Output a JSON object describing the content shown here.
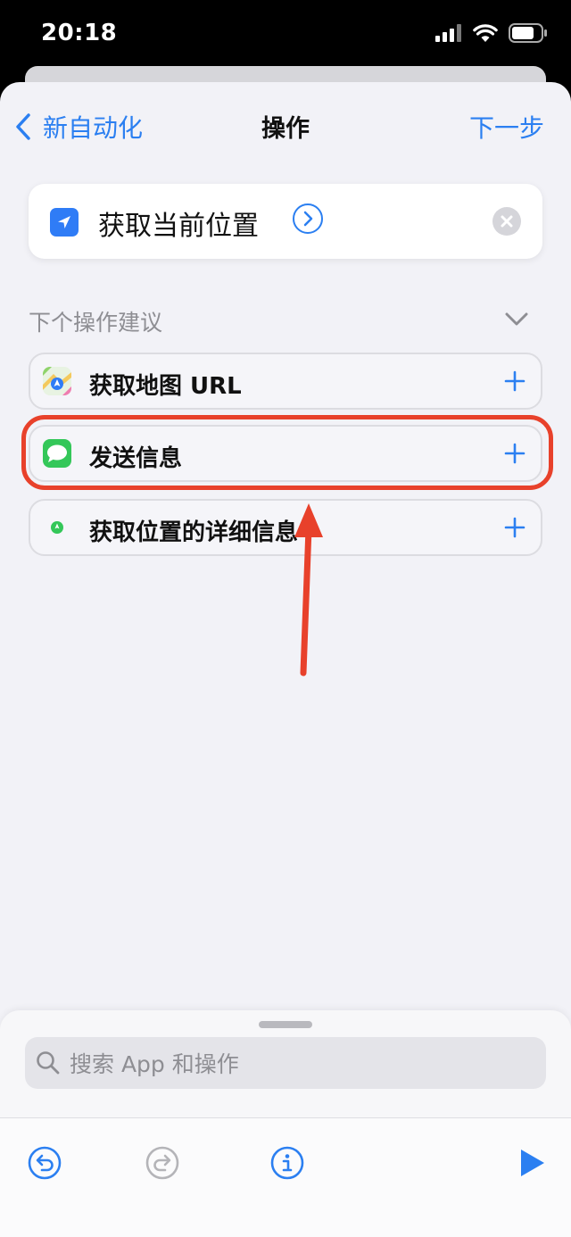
{
  "status_bar": {
    "time": "20:18"
  },
  "nav": {
    "back_label": "新自动化",
    "title": "操作",
    "next_label": "下一步"
  },
  "current_action": {
    "label": "获取当前位置"
  },
  "suggestions": {
    "title": "下个操作建议",
    "items": [
      {
        "label": "获取地图 URL",
        "icon": "maps-app-icon"
      },
      {
        "label": "发送信息",
        "icon": "messages-app-icon"
      },
      {
        "label": "获取位置的详细信息",
        "icon": "location-info-icon"
      }
    ]
  },
  "search": {
    "placeholder": "搜索 App 和操作"
  },
  "colors": {
    "accent": "#2b7ff1",
    "highlight": "#e8412b",
    "background": "#f2f2f7"
  },
  "toolbar": {
    "icons": [
      "undo-icon",
      "redo-icon",
      "info-icon",
      "play-icon"
    ]
  }
}
